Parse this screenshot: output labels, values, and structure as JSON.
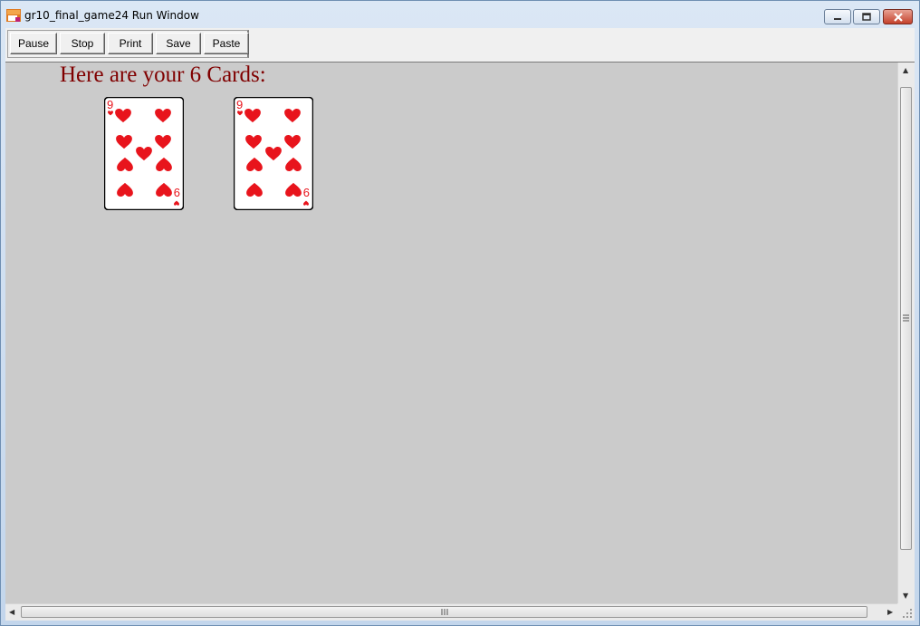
{
  "window": {
    "title": "gr10_final_game24 Run Window"
  },
  "toolbar": {
    "buttons": [
      "Pause",
      "Stop",
      "Print",
      "Save",
      "Paste"
    ]
  },
  "content": {
    "heading": "Here are your 6 Cards:",
    "cards": [
      {
        "rank": "9",
        "suit": "hearts"
      },
      {
        "rank": "9",
        "suit": "hearts"
      }
    ]
  },
  "colors": {
    "heading": "#800000",
    "canvas": "#cbcbcb",
    "suit": "#e8141c"
  },
  "icons": [
    "app-icon",
    "minimize-icon",
    "maximize-icon",
    "close-icon",
    "scroll-up-icon",
    "scroll-down-icon",
    "scroll-left-icon",
    "scroll-right-icon",
    "resize-grip-icon"
  ]
}
